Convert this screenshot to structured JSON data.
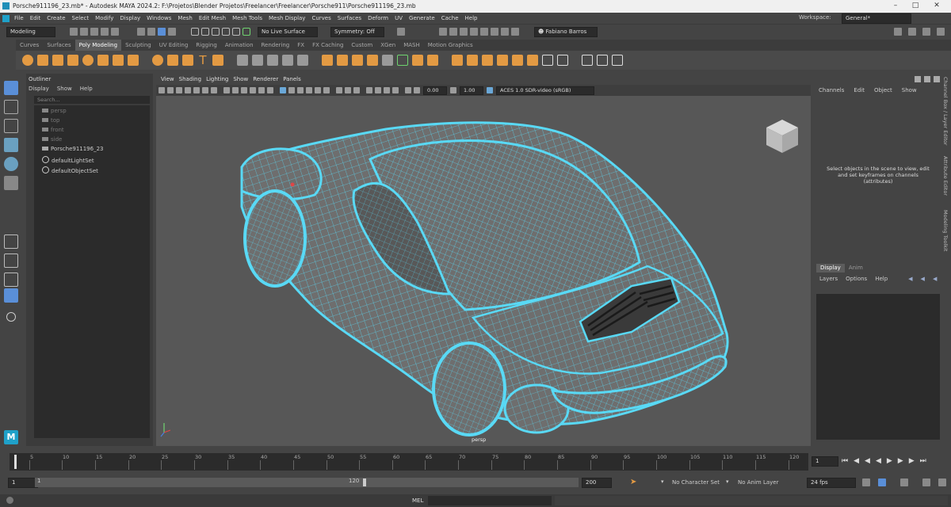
{
  "window": {
    "title": "Porsche911196_23.mb* - Autodesk MAYA 2024.2: F:\\Projetos\\Blender Projetos\\Freelancer\\Freelancer\\Porsche911\\Porsche911196_23.mb"
  },
  "menubar": {
    "items": [
      "File",
      "Edit",
      "Create",
      "Select",
      "Modify",
      "Display",
      "Windows",
      "Mesh",
      "Edit Mesh",
      "Mesh Tools",
      "Mesh Display",
      "Curves",
      "Surfaces",
      "Deform",
      "UV",
      "Generate",
      "Cache",
      "Help"
    ],
    "workspace_label": "Workspace:",
    "workspace_value": "General*"
  },
  "statusline": {
    "menuset": "Modeling",
    "live_surface": "No Live Surface",
    "symmetry": "Symmetry: Off",
    "user": "Fabiano Barros"
  },
  "shelf": {
    "tabs": [
      "Curves",
      "Surfaces",
      "Poly Modeling",
      "Sculpting",
      "UV Editing",
      "Rigging",
      "Animation",
      "Rendering",
      "FX",
      "FX Caching",
      "Custom",
      "XGen",
      "MASH",
      "Motion Graphics"
    ],
    "active_tab": "Poly Modeling"
  },
  "outliner": {
    "title": "Outliner",
    "menu": [
      "Display",
      "Show",
      "Help"
    ],
    "search_placeholder": "Search...",
    "items": [
      "persp",
      "top",
      "front",
      "side",
      "Porsche911196_23",
      "defaultLightSet",
      "defaultObjectSet"
    ]
  },
  "viewport": {
    "menu": [
      "View",
      "Shading",
      "Lighting",
      "Show",
      "Renderer",
      "Panels"
    ],
    "near_value": "0.00",
    "far_value": "1.00",
    "color_space": "ACES 1.0 SDR-video (sRGB)",
    "camera_label": "persp",
    "colors": {
      "wire": "#59d9f5",
      "mesh": "#6e6e6e",
      "background": "#575757"
    }
  },
  "channelbox": {
    "menu": [
      "Channels",
      "Edit",
      "Object",
      "Show"
    ],
    "message": "Select objects in the scene to view, edit and set keyframes on channels (attributes)",
    "layer_tabs": [
      "Display",
      "Anim"
    ],
    "layer_menu": [
      "Layers",
      "Options",
      "Help"
    ],
    "side_tabs": [
      "Channel Box / Layer Editor",
      "Attribute Editor",
      "Modeling Toolkit"
    ]
  },
  "timeline": {
    "ticks": [
      "5",
      "10",
      "15",
      "20",
      "25",
      "30",
      "35",
      "40",
      "45",
      "50",
      "55",
      "60",
      "65",
      "70",
      "75",
      "80",
      "85",
      "90",
      "95",
      "100",
      "105",
      "110",
      "115",
      "120"
    ],
    "current_frame": "1",
    "range_start": "1",
    "range_inner_start": "1",
    "range_inner_end": "120",
    "range_end": "200",
    "character_set": "No Character Set",
    "anim_layer": "No Anim Layer",
    "fps": "24 fps"
  },
  "commandline": {
    "label": "MEL"
  }
}
